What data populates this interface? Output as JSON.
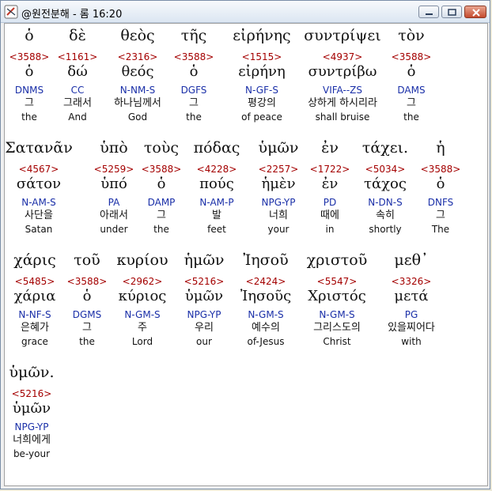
{
  "window": {
    "title": "@원전분해 - 롬 16:20"
  },
  "words": [
    {
      "greek": "ὁ",
      "strong": "<3588>",
      "lemma": "ὁ",
      "parse": "DNMS",
      "korean": "그",
      "english": "the"
    },
    {
      "greek": "δὲ",
      "strong": "<1161>",
      "lemma": "δώ",
      "parse": "CC",
      "korean": "그래서",
      "english": "And"
    },
    {
      "greek": "θεὸς",
      "strong": "<2316>",
      "lemma": "θεός",
      "parse": "N-NM-S",
      "korean": "하나님께서",
      "english": "God"
    },
    {
      "greek": "τῆς",
      "strong": "<3588>",
      "lemma": "ὁ",
      "parse": "DGFS",
      "korean": "그",
      "english": "the"
    },
    {
      "greek": "εἰρήνης",
      "strong": "<1515>",
      "lemma": "εἰρήνη",
      "parse": "N-GF-S",
      "korean": "평강의",
      "english": "of peace"
    },
    {
      "greek": "συντρίψει",
      "strong": "<4937>",
      "lemma": "συντρίβω",
      "parse": "VIFA--ZS",
      "korean": "상하게 하시리라",
      "english": "shall bruise"
    },
    {
      "greek": "τὸν",
      "strong": "<3588>",
      "lemma": "ὁ",
      "parse": "DAMS",
      "korean": "그",
      "english": "the"
    },
    {
      "greek": "Σατανᾶν",
      "strong": "<4567>",
      "lemma": "σάτον",
      "parse": "N-AM-S",
      "korean": "사단을",
      "english": "Satan"
    },
    {
      "greek": "ὑπὸ",
      "strong": "<5259>",
      "lemma": "ὑπό",
      "parse": "PA",
      "korean": "아래서",
      "english": "under"
    },
    {
      "greek": "τοὺς",
      "strong": "<3588>",
      "lemma": "ὁ",
      "parse": "DAMP",
      "korean": "그",
      "english": "the"
    },
    {
      "greek": "πόδας",
      "strong": "<4228>",
      "lemma": "πούς",
      "parse": "N-AM-P",
      "korean": "발",
      "english": "feet"
    },
    {
      "greek": "ὑμῶν",
      "strong": "<2257>",
      "lemma": "ἡμὲν",
      "parse": "NPG-YP",
      "korean": "너희",
      "english": "your"
    },
    {
      "greek": "ἐν",
      "strong": "<1722>",
      "lemma": "ἐν",
      "parse": "PD",
      "korean": "때에",
      "english": "in"
    },
    {
      "greek": "τάχει.",
      "strong": "<5034>",
      "lemma": "τάχος",
      "parse": "N-DN-S",
      "korean": "속히",
      "english": "shortly"
    },
    {
      "greek": "ἡ",
      "strong": "<3588>",
      "lemma": "ὁ",
      "parse": "DNFS",
      "korean": "그",
      "english": "The"
    },
    {
      "greek": "χάρις",
      "strong": "<5485>",
      "lemma": "χάρια",
      "parse": "N-NF-S",
      "korean": "은혜가",
      "english": "grace"
    },
    {
      "greek": "τοῦ",
      "strong": "<3588>",
      "lemma": "ὁ",
      "parse": "DGMS",
      "korean": "그",
      "english": "the"
    },
    {
      "greek": "κυρίου",
      "strong": "<2962>",
      "lemma": "κύριος",
      "parse": "N-GM-S",
      "korean": "주",
      "english": "Lord"
    },
    {
      "greek": "ἡμῶν",
      "strong": "<5216>",
      "lemma": "ὑμῶν",
      "parse": "NPG-YP",
      "korean": "우리",
      "english": "our"
    },
    {
      "greek": "Ἰησοῦ",
      "strong": "<2424>",
      "lemma": "Ἰησοῦς",
      "parse": "N-GM-S",
      "korean": "예수의",
      "english": "of-Jesus"
    },
    {
      "greek": "χριστοῦ",
      "strong": "<5547>",
      "lemma": "Χριστός",
      "parse": "N-GM-S",
      "korean": "그리스도의",
      "english": "Christ"
    },
    {
      "greek": "μεθ᾽",
      "strong": "<3326>",
      "lemma": "μετά",
      "parse": "PG",
      "korean": "있을찌어다",
      "english": "with"
    },
    {
      "greek": "ὑμῶν.",
      "strong": "<5216>",
      "lemma": "ὑμῶν",
      "parse": "NPG-YP",
      "korean": "너희에게",
      "english": "be-your"
    }
  ]
}
